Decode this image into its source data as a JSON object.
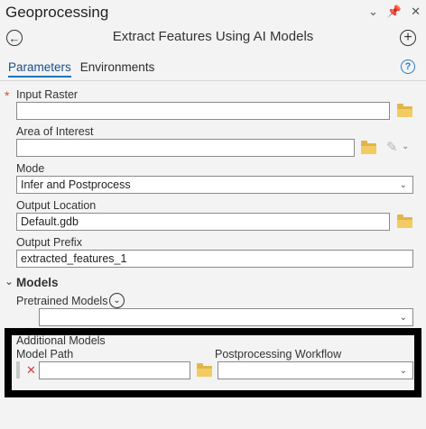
{
  "pane": {
    "title": "Geoprocessing"
  },
  "tool": {
    "title": "Extract Features Using AI Models"
  },
  "tabs": {
    "parameters": "Parameters",
    "environments": "Environments"
  },
  "params": {
    "input_raster": {
      "label": "Input Raster",
      "value": ""
    },
    "area_of_interest": {
      "label": "Area of Interest",
      "value": ""
    },
    "mode": {
      "label": "Mode",
      "value": "Infer and Postprocess"
    },
    "output_location": {
      "label": "Output Location",
      "value": "Default.gdb"
    },
    "output_prefix": {
      "label": "Output Prefix",
      "value": "extracted_features_1"
    }
  },
  "models": {
    "section_label": "Models",
    "pretrained_label": "Pretrained Models",
    "pretrained_value": "",
    "additional_label": "Additional Models",
    "model_path_label": "Model Path",
    "postprocessing_label": "Postprocessing Workflow",
    "model_path_value": "",
    "postprocessing_value": ""
  },
  "colors": {
    "accent": "#1b75bb",
    "required": "#d9541e",
    "folder": "#e0b64a"
  }
}
